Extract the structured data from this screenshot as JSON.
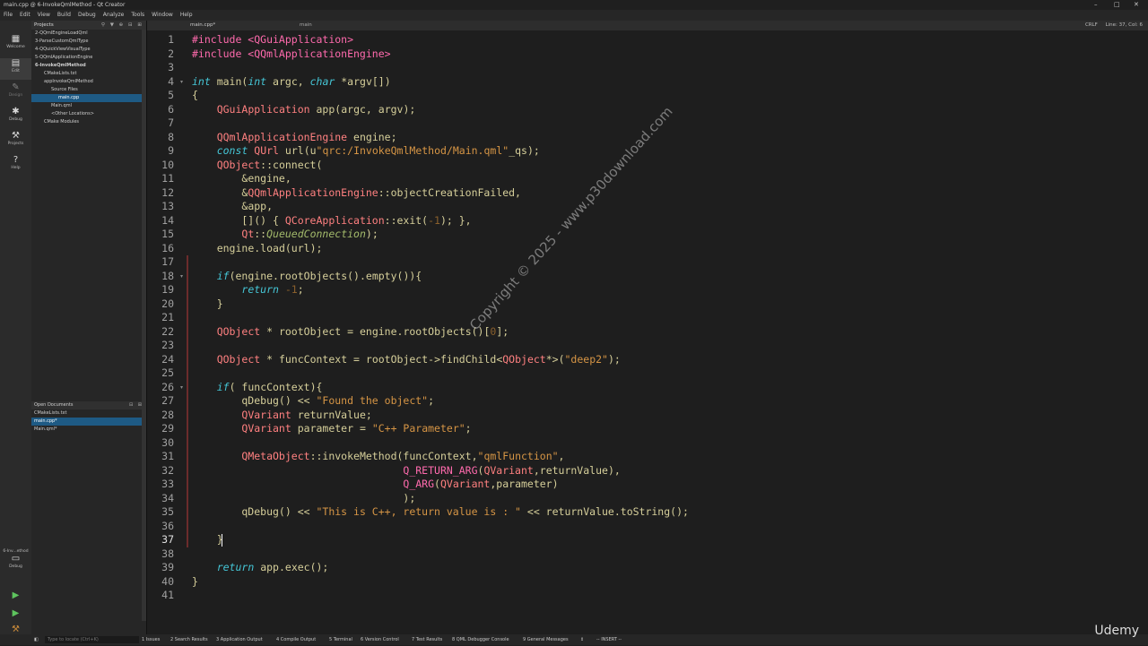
{
  "window": {
    "title": "main.cpp @ 6-InvokeQmlMethod - Qt Creator",
    "minimize": "–",
    "maximize": "□",
    "close": "✕"
  },
  "menu": [
    "File",
    "Edit",
    "View",
    "Build",
    "Debug",
    "Analyze",
    "Tools",
    "Window",
    "Help"
  ],
  "modes": [
    {
      "label": "Welcome",
      "icon": "grid-icon"
    },
    {
      "label": "Edit",
      "icon": "document-icon"
    },
    {
      "label": "Design",
      "icon": "pen-icon"
    },
    {
      "label": "Debug",
      "icon": "bug-icon"
    },
    {
      "label": "Projects",
      "icon": "wrench-icon"
    },
    {
      "label": "Help",
      "icon": "question-icon"
    }
  ],
  "kit": {
    "label": "6-Inv...ethod",
    "sub": "Debug"
  },
  "projects_panel": {
    "title": "Projects"
  },
  "tree": [
    "2-QQmlEngineLoadQml",
    "3-ParseCustomQmlType",
    "4-QQuickViewVisualType",
    "5-QQmlApplicationEngine",
    "6-InvokeQmlMethod",
    "CMakeLists.txt",
    "appInvokeQmlMethod",
    "Source Files",
    "main.cpp",
    "Main.qml",
    "<Other Locations>",
    "CMake Modules"
  ],
  "open_documents": {
    "title": "Open Documents",
    "items": [
      "CMakeLists.txt",
      "main.cpp*",
      "Main.qml*"
    ]
  },
  "editor": {
    "file_tab": "main.cpp*",
    "crumb": "main",
    "line_ending": "CRLF",
    "position": "Line: 37, Col: 6"
  },
  "code_lines": [
    "#include <QGuiApplication>",
    "#include <QQmlApplicationEngine>",
    "",
    "int main(int argc, char *argv[])",
    "{",
    "    QGuiApplication app(argc, argv);",
    "",
    "    QQmlApplicationEngine engine;",
    "    const QUrl url(u\"qrc:/InvokeQmlMethod/Main.qml\"_qs);",
    "    QObject::connect(",
    "        &engine,",
    "        &QQmlApplicationEngine::objectCreationFailed,",
    "        &app,",
    "        []() { QCoreApplication::exit(-1); },",
    "        Qt::QueuedConnection);",
    "    engine.load(url);",
    "",
    "    if(engine.rootObjects().empty()){",
    "        return -1;",
    "    }",
    "",
    "    QObject * rootObject = engine.rootObjects()[0];",
    "",
    "    QObject * funcContext = rootObject->findChild<QObject*>(\"deep2\");",
    "",
    "    if( funcContext){",
    "        qDebug() << \"Found the object\";",
    "        QVariant returnValue;",
    "        QVariant parameter = \"C++ Parameter\";",
    "",
    "        QMetaObject::invokeMethod(funcContext,\"qmlFunction\",",
    "                                  Q_RETURN_ARG(QVariant,returnValue),",
    "                                  Q_ARG(QVariant,parameter)",
    "                                  );",
    "        qDebug() << \"This is C++, return value is : \" << returnValue.toString();",
    "",
    "    }",
    "",
    "    return app.exec();",
    "}",
    ""
  ],
  "watermark": "Copyright © 2025 - www.p30download.com",
  "status": {
    "locate_placeholder": "Type to locate (Ctrl+K)",
    "items": [
      "1 Issues",
      "2 Search Results",
      "3 Application Output",
      "4 Compile Output",
      "5 Terminal",
      "6 Version Control",
      "7 Test Results",
      "8 QML Debugger Console",
      "9 General Messages"
    ],
    "mode": "-- INSERT --"
  },
  "brand": "Udemy"
}
